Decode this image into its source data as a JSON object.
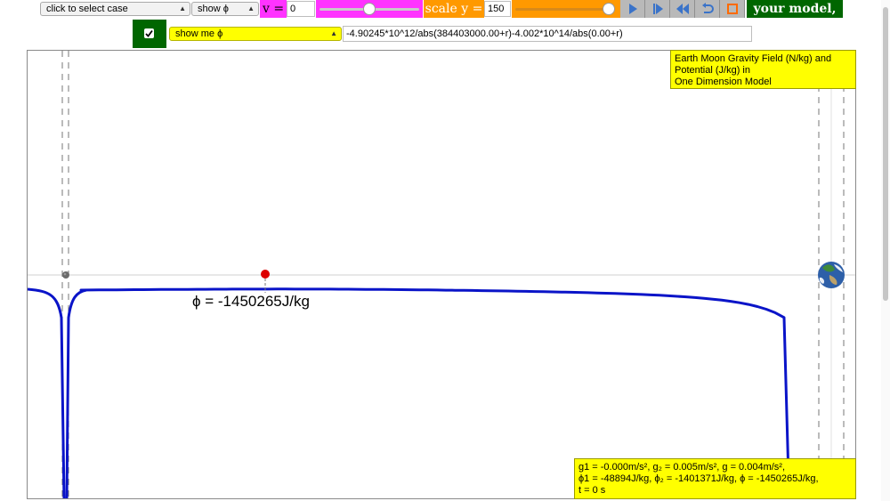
{
  "toolbar": {
    "case_select": "click to select case",
    "show_select": "show ϕ",
    "v_label": "v =",
    "v_value": "0",
    "v_slider_fraction": 0.5,
    "scale_label": "scale y =",
    "scale_value": "150",
    "scale_slider_fraction": 1.0,
    "model_label": "your model, ϕ="
  },
  "formula_row": {
    "checkbox_checked": true,
    "show_me_select": "show me ϕ",
    "formula": "-4.90245*10^12/abs(384403000.00+r)-4.002*10^14/abs(0.00+r)"
  },
  "plot": {
    "title_box": "Earth Moon Gravity Field (N/kg) and Potential (J/kg) in One Dimension Model",
    "title_lines": [
      "Earth Moon Gravity Field (N/kg) and",
      "Potential (J/kg) in",
      "One Dimension Model"
    ],
    "phi_readout": "ϕ = -1450265J/kg",
    "stats": {
      "line1": "g1 = -0.000m/s², g₂ = 0.005m/s², g = 0.004m/s²,",
      "line2": "ϕ1 = -48894J/kg, ϕ₂ = -1401371J/kg, ϕ = -1450265J/kg,",
      "line3": "t = 0 s"
    },
    "curve_color": "#0a14c8",
    "probe_color": "#dd0000"
  },
  "colors": {
    "magenta": "#ff33ff",
    "orange": "#ff9900",
    "green": "#006600",
    "yellow": "#ffff00"
  }
}
